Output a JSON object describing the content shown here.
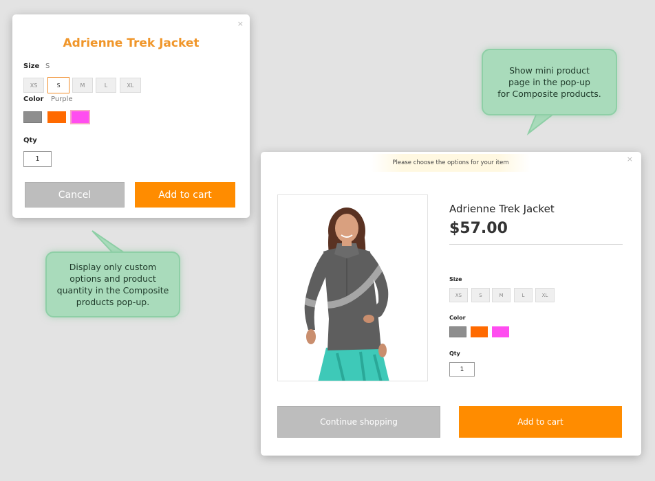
{
  "small_popup": {
    "close": "×",
    "title": "Adrienne Trek Jacket",
    "size_label": "Size",
    "size_value": "S",
    "sizes": [
      "XS",
      "S",
      "M",
      "L",
      "XL"
    ],
    "selected_size": "S",
    "color_label": "Color",
    "color_value": "Purple",
    "colors": [
      "#8e8e8e",
      "#ff6a00",
      "#ff4df0"
    ],
    "qty_label": "Qty",
    "qty_value": "1",
    "cancel_label": "Cancel",
    "add_label": "Add to cart"
  },
  "large_popup": {
    "close": "×",
    "notice": "Please choose the options for your item",
    "product_name": "Adrienne Trek Jacket",
    "price": "$57.00",
    "size_label": "Size",
    "sizes": [
      "XS",
      "S",
      "M",
      "L",
      "XL"
    ],
    "color_label": "Color",
    "colors": [
      "#8e8e8e",
      "#ff6a00",
      "#ff4df0"
    ],
    "qty_label": "Qty",
    "qty_value": "1",
    "continue_label": "Continue shopping",
    "add_label": "Add to cart"
  },
  "callouts": {
    "top_right": [
      "Show mini product",
      "page in the pop-up",
      "for Composite products."
    ],
    "bottom_left": [
      "Display only custom",
      "options and product",
      "quantity in the Composite",
      "products pop-up."
    ]
  },
  "colors": {
    "accent": "#ff8c00",
    "title_orange": "#f0962a",
    "cancel_gray": "#bdbdbd",
    "bubble_green": "#a9dbbb"
  }
}
